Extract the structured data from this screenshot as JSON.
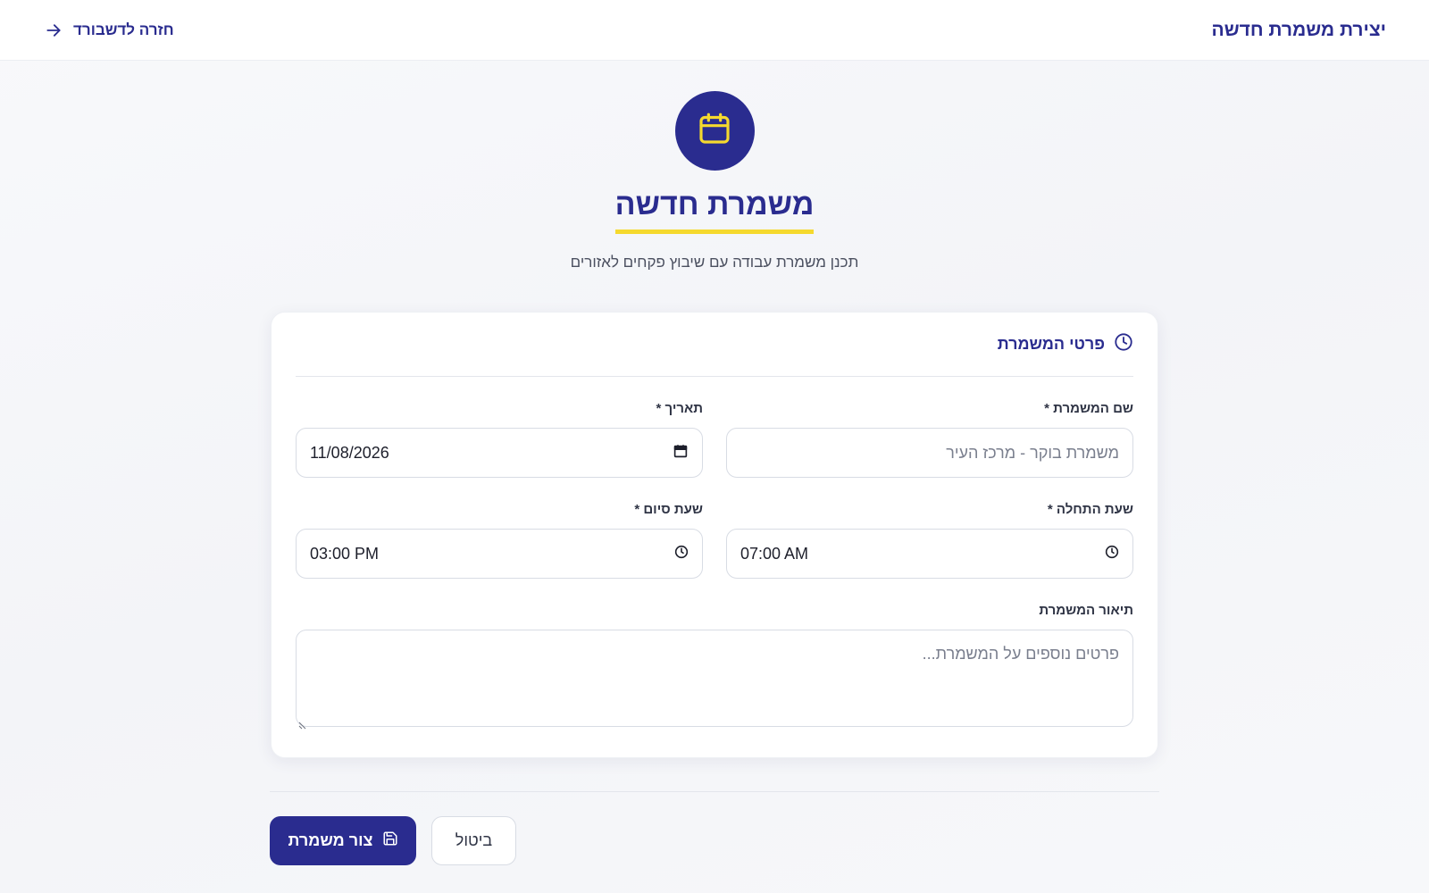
{
  "header": {
    "title": "יצירת משמרת חדשה",
    "back_label": "חזרה לדשבורד"
  },
  "hero": {
    "icon": "calendar-icon",
    "title": "משמרת חדשה",
    "subtitle": "תכנן משמרת עבודה עם שיבוץ פקחים לאזורים"
  },
  "card": {
    "title": "פרטי המשמרת",
    "icon": "clock-icon",
    "fields": {
      "shift_name": {
        "label": "שם המשמרת *",
        "placeholder": "משמרת בוקר - מרכז העיר",
        "value": ""
      },
      "date": {
        "label": "תאריך *",
        "value": "11/08/2026"
      },
      "start_time": {
        "label": "שעת התחלה *",
        "value": "07:00 AM"
      },
      "end_time": {
        "label": "שעת סיום *",
        "value": "03:00 PM"
      },
      "description": {
        "label": "תיאור המשמרת",
        "placeholder": "פרטים נוספים על המשמרת..."
      }
    }
  },
  "actions": {
    "create_label": "צור משמרת",
    "cancel_label": "ביטול"
  },
  "colors": {
    "primary": "#2a2c8f",
    "accent": "#f5d92e",
    "border": "#d8dce4"
  }
}
